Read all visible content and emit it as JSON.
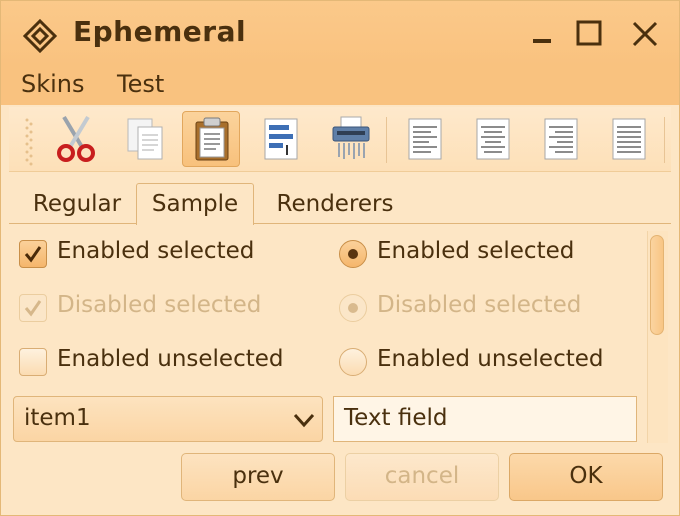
{
  "window": {
    "title": "Ephemeral",
    "buttons": {
      "minimize_icon": "minimize-icon",
      "maximize_icon": "maximize-icon",
      "close_icon": "close-icon"
    }
  },
  "menu": {
    "items": [
      "Skins",
      "Test"
    ]
  },
  "toolbar": {
    "icons": [
      "cut-icon",
      "copy-icon",
      "paste-icon",
      "document-properties-icon",
      "shredder-icon",
      "align-left-icon",
      "align-center-icon",
      "align-right-icon",
      "align-justify-icon"
    ],
    "active": "paste-icon"
  },
  "tabs": {
    "items": [
      "Regular",
      "Sample",
      "Renderers"
    ],
    "selected": "Sample"
  },
  "checkboxes": [
    {
      "label": "Enabled selected",
      "checked": true,
      "enabled": true
    },
    {
      "label": "Disabled selected",
      "checked": true,
      "enabled": false
    },
    {
      "label": "Enabled unselected",
      "checked": false,
      "enabled": true
    }
  ],
  "radios": [
    {
      "label": "Enabled selected",
      "checked": true,
      "enabled": true
    },
    {
      "label": "Disabled selected",
      "checked": true,
      "enabled": false
    },
    {
      "label": "Enabled unselected",
      "checked": false,
      "enabled": true
    }
  ],
  "combo": {
    "value": "item1"
  },
  "textfield": {
    "value": "Text field"
  },
  "buttons": {
    "prev": "prev",
    "cancel": "cancel",
    "ok": "OK"
  },
  "colors": {
    "titlebar": "#f9c27f",
    "accent": "#f5b66c",
    "background": "#fde6c5",
    "text": "#4a300e",
    "disabled_text": "#d3b588"
  }
}
